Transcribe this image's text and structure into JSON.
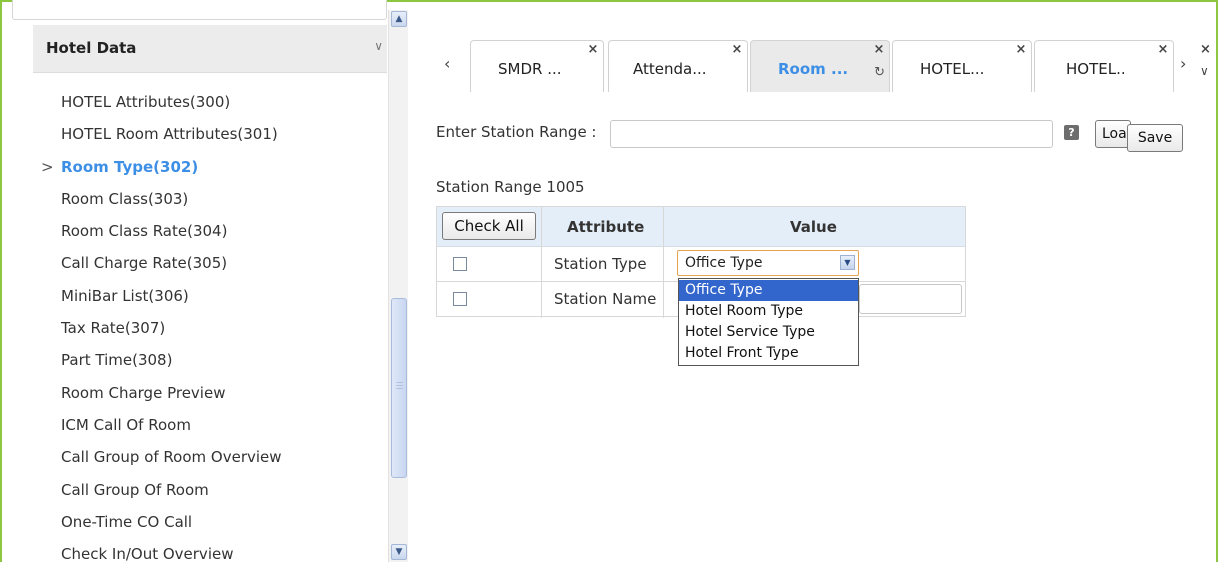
{
  "sidebar": {
    "section_title": "Hotel Data",
    "items": [
      {
        "label": "HOTEL Attributes(300)"
      },
      {
        "label": "HOTEL Room Attributes(301)"
      },
      {
        "label": "Room Type(302)"
      },
      {
        "label": "Room Class(303)"
      },
      {
        "label": "Room Class Rate(304)"
      },
      {
        "label": "Call Charge Rate(305)"
      },
      {
        "label": "MiniBar List(306)"
      },
      {
        "label": "Tax Rate(307)"
      },
      {
        "label": "Part Time(308)"
      },
      {
        "label": "Room Charge Preview"
      },
      {
        "label": "ICM Call Of Room"
      },
      {
        "label": "Call Group of Room Overview"
      },
      {
        "label": "Call Group Of Room"
      },
      {
        "label": "One-Time CO Call"
      },
      {
        "label": "Check In/Out Overview"
      }
    ],
    "active_index": 2
  },
  "tabs": [
    {
      "label": "SMDR ...",
      "active": false
    },
    {
      "label": "Attenda...",
      "active": false
    },
    {
      "label": "Room ...",
      "active": true
    },
    {
      "label": "HOTEL...",
      "active": false
    },
    {
      "label": "HOTEL..",
      "active": false
    }
  ],
  "form": {
    "station_range_label": "Enter Station Range :",
    "station_range_value": "",
    "help_glyph": "?",
    "load_label": "Load",
    "save_label": "Save",
    "range_title": "Station Range 1005"
  },
  "grid": {
    "check_all_label": "Check All",
    "col_attribute": "Attribute",
    "col_value": "Value",
    "rows": [
      {
        "attribute": "Station Type",
        "value": "Office Type"
      },
      {
        "attribute": "Station Name",
        "value": ""
      }
    ]
  },
  "dropdown": {
    "options": [
      "Office Type",
      "Hotel Room Type",
      "Hotel Service Type",
      "Hotel Front Type"
    ],
    "selected_index": 0
  },
  "colors": {
    "accent": "#3d8fe6",
    "frame": "#8dc63f",
    "option_highlight": "#3366cc",
    "select_border": "#e3a554"
  }
}
